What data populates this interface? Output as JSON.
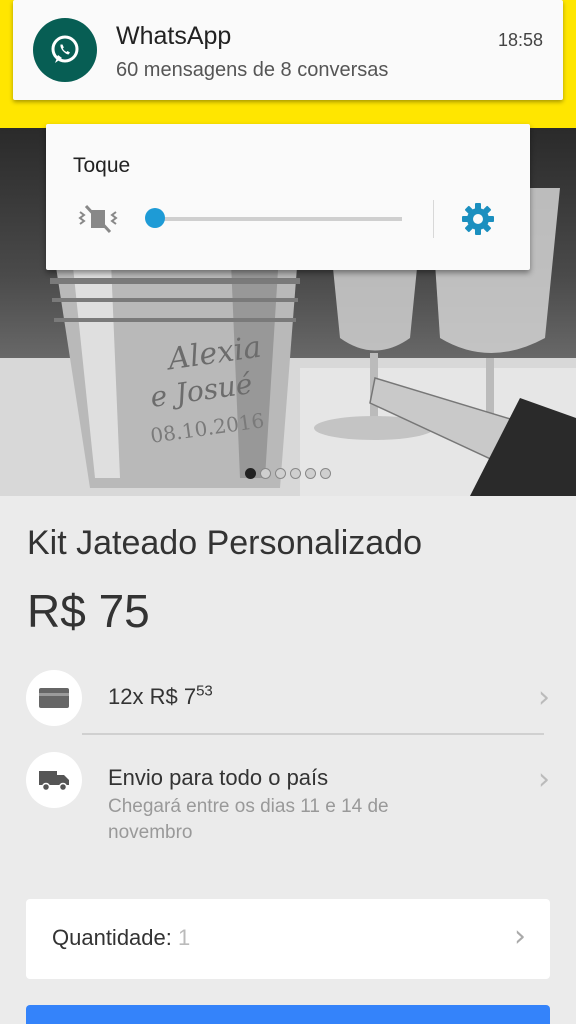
{
  "notification": {
    "app": "WhatsApp",
    "time": "18:58",
    "text": "60 mensagens de 8 conversas",
    "icon": "whatsapp-icon"
  },
  "volume": {
    "label": "Toque",
    "level": 0.0,
    "mute_icon": "vibrate-mute-icon",
    "settings_icon": "gear-icon",
    "accent": "#1e9bd6"
  },
  "gallery": {
    "image_count": 6,
    "active_index": 0,
    "engraving": [
      "Alexia",
      "e Josué",
      "08.10.2016"
    ]
  },
  "product": {
    "title": "Kit Jateado Personalizado",
    "price": "R$ 75"
  },
  "installments": {
    "prefix": "12x R$ 7",
    "cents": "53",
    "icon": "credit-card-icon"
  },
  "shipping": {
    "title": "Envio para todo o país",
    "detail": "Chegará entre os dias 11 e 14 de novembro",
    "icon": "truck-icon"
  },
  "quantity": {
    "label": "Quantidade:",
    "value": "1"
  },
  "colors": {
    "appbar": "#ffe600",
    "whatsapp": "#075e54",
    "buy_button": "#3483fa"
  }
}
